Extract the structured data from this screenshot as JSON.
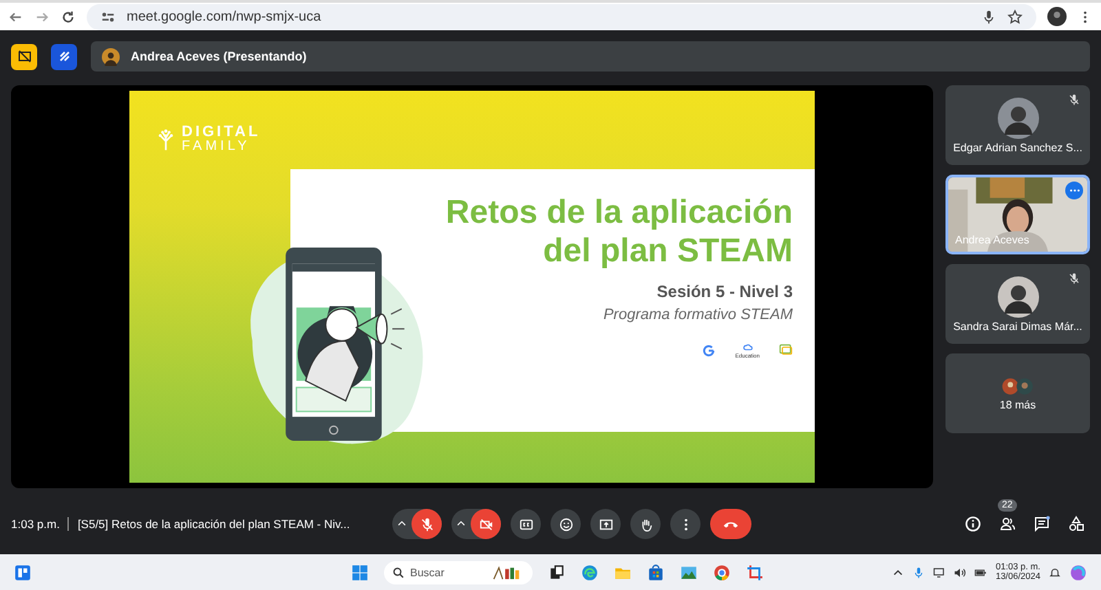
{
  "browser": {
    "url": "meet.google.com/nwp-smjx-uca"
  },
  "presenter": {
    "label": "Andrea Aceves (Presentando)"
  },
  "slide": {
    "brand_top": "DIGITAL",
    "brand_bottom": "FAMILY",
    "title_lines": [
      "Retos de la aplicación",
      "del plan STEAM"
    ],
    "session": "Sesión 5 - Nivel 3",
    "program": "Programa formativo STEAM",
    "partner_label": "Education"
  },
  "participants": [
    {
      "name": "Edgar Adrian Sanchez S...",
      "kind": "avatar",
      "muted": true,
      "selected": false
    },
    {
      "name": "Andrea Aceves",
      "kind": "video",
      "muted": false,
      "selected": true
    },
    {
      "name": "Sandra Sarai Dimas Már...",
      "kind": "avatar",
      "muted": true,
      "selected": false
    }
  ],
  "more": {
    "label": "18 más"
  },
  "controls": {
    "time": "1:03 p.m.",
    "meeting_title": "[S5/5] Retos de la aplicación del plan STEAM - Niv...",
    "mic_on": false,
    "camera_on": false,
    "people_count": "22"
  },
  "taskbar": {
    "search_placeholder": "Buscar",
    "time": "01:03 p. m.",
    "date": "13/06/2024"
  }
}
